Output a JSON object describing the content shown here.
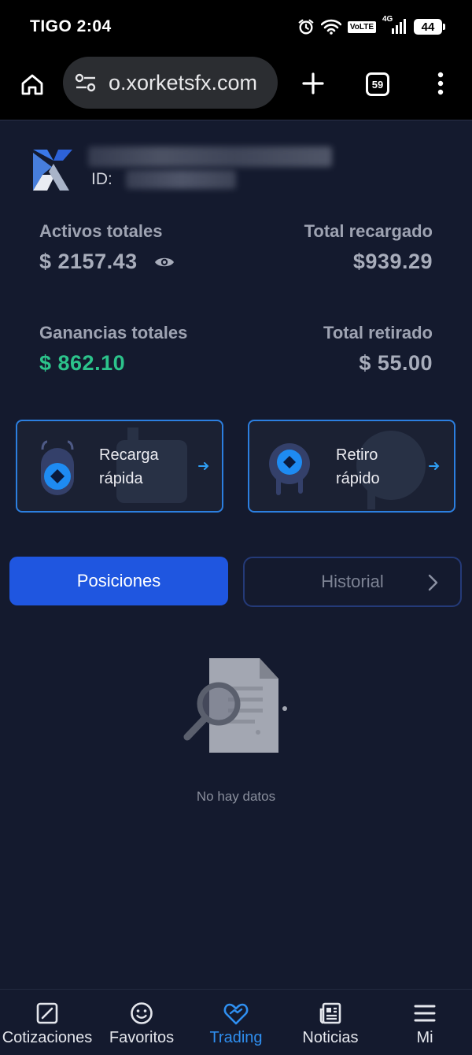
{
  "status_bar": {
    "carrier_time": "TIGO 2:04",
    "volte": "VoLTE",
    "network": "4G",
    "battery": "44"
  },
  "browser": {
    "url": "o.xorketsfx.com",
    "tab_count": "59"
  },
  "account": {
    "id_label": "ID:"
  },
  "stats": {
    "total_assets_label": "Activos totales",
    "total_assets_value": "$ 2157.43",
    "total_recharged_label": "Total recargado",
    "total_recharged_value": "$939.29",
    "total_profit_label": "Ganancias totales",
    "total_profit_value": "$ 862.10",
    "total_withdrawn_label": "Total retirado",
    "total_withdrawn_value": "$ 55.00"
  },
  "quick_actions": {
    "recharge_line1": "Recarga",
    "recharge_line2": "rápida",
    "withdraw_line1": "Retiro",
    "withdraw_line2": "rápido"
  },
  "tabs": {
    "positions": "Posiciones",
    "history": "Historial"
  },
  "empty_state": {
    "text": "No hay datos"
  },
  "bottom_nav": {
    "items": [
      {
        "label": "Cotizaciones",
        "icon": "chart-square-icon"
      },
      {
        "label": "Favoritos",
        "icon": "smiley-icon"
      },
      {
        "label": "Trading",
        "icon": "heart-handshake-icon",
        "active": true
      },
      {
        "label": "Noticias",
        "icon": "newspaper-icon"
      },
      {
        "label": "Mi",
        "icon": "menu-lines-icon"
      }
    ]
  },
  "colors": {
    "background": "#141a2e",
    "accent_blue": "#1f56e0",
    "active_nav": "#2f8ff0",
    "profit_green": "#2cc38b",
    "card_border": "#2c7fe0"
  }
}
